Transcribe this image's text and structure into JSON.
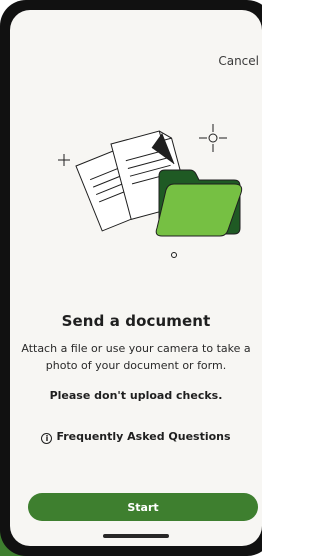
{
  "header": {
    "cancel_label": "Cancel"
  },
  "main": {
    "title": "Send a document",
    "description": "Attach a file or use your camera to take a photo of your document or form.",
    "warning": "Please don't upload checks.",
    "faq_label": "Frequently Asked Questions"
  },
  "footer": {
    "start_label": "Start"
  },
  "icons": {
    "info": "info-icon",
    "illustration": "documents-folder-illustration"
  },
  "colors": {
    "accent_green": "#3e7f2f",
    "folder_green_light": "#76c043",
    "folder_green_dark": "#1f5a24",
    "text_primary": "#1f1f1f",
    "screen_bg": "#f7f6f3"
  }
}
